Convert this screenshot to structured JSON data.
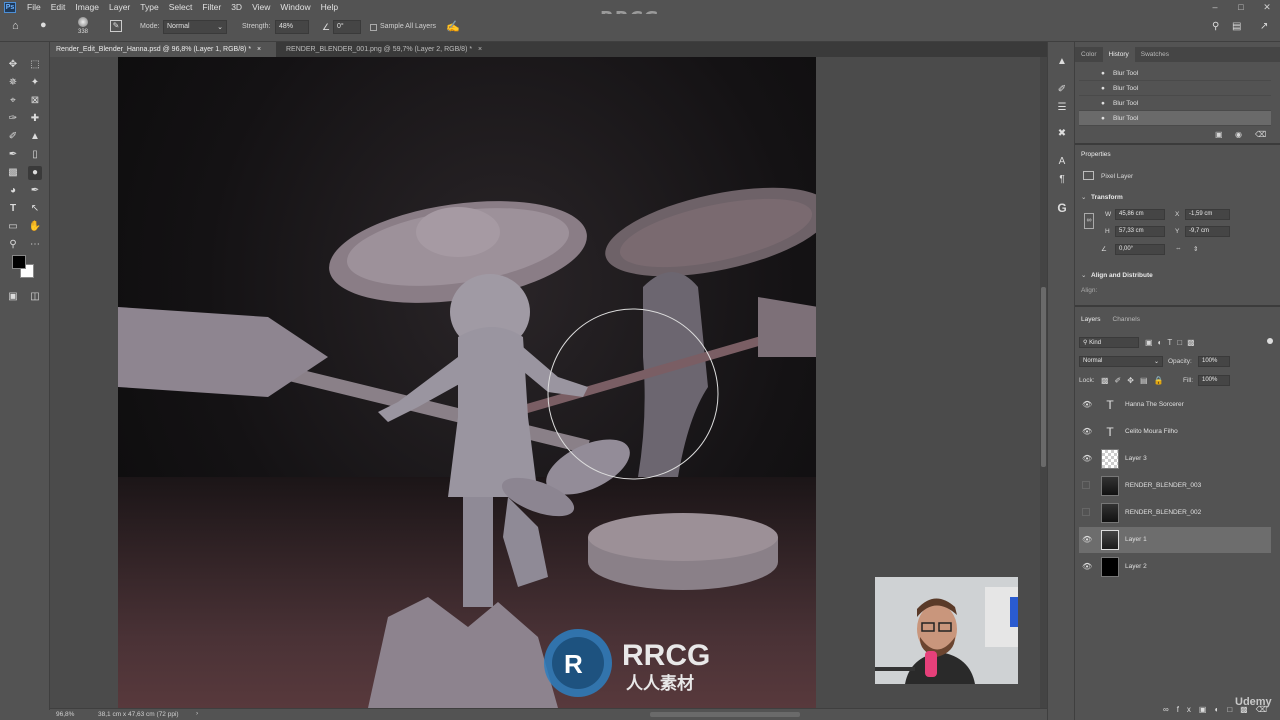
{
  "menubar": {
    "logo": "Ps",
    "items": [
      "File",
      "Edit",
      "Image",
      "Layer",
      "Type",
      "Select",
      "Filter",
      "3D",
      "View",
      "Window",
      "Help"
    ]
  },
  "watermark": {
    "top": "RRCG.cn",
    "logo_text": "RRCG",
    "logo_sub": "人人素材"
  },
  "options": {
    "brush_size": "338",
    "mode_label": "Mode:",
    "mode_value": "Normal",
    "strength_label": "Strength:",
    "strength_value": "48%",
    "angle_value": "0°",
    "sample_all_label": "Sample All Layers"
  },
  "tabs": [
    {
      "label": "Render_Edit_Blender_Hanna.psd @ 96,8% (Layer 1, RGB/8) *",
      "close": "×"
    },
    {
      "label": "RENDER_BLENDER_001.png @ 59,7% (Layer 2, RGB/8) *",
      "close": "×"
    }
  ],
  "statusbar": {
    "zoom": "96,8%",
    "doc_info": "38,1 cm x 47,63 cm (72 ppi)",
    "arrow": "›"
  },
  "history_panel": {
    "tabs": [
      "Color",
      "History",
      "Swatches"
    ],
    "items": [
      "Blur Tool",
      "Blur Tool",
      "Blur Tool",
      "Blur Tool"
    ]
  },
  "properties_panel": {
    "title": "Properties",
    "type": "Pixel Layer",
    "transform_title": "Transform",
    "w_label": "W",
    "w_value": "45,86 cm",
    "x_label": "X",
    "x_value": "-1,59 cm",
    "h_label": "H",
    "h_value": "57,33 cm",
    "y_label": "Y",
    "y_value": "-9,7 cm",
    "angle_value": "0,00°",
    "align_title": "Align and Distribute",
    "align_label": "Align:"
  },
  "layers_panel": {
    "tabs": [
      "Layers",
      "Channels"
    ],
    "filter_label": "Kind",
    "blend_mode": "Normal",
    "opacity_label": "Opacity:",
    "opacity_value": "100%",
    "lock_label": "Lock:",
    "fill_label": "Fill:",
    "fill_value": "100%",
    "layers": [
      {
        "name": "Hanna The Sorcerer",
        "kind": "text",
        "visible": true
      },
      {
        "name": "Celito Moura Filho",
        "kind": "text",
        "visible": true
      },
      {
        "name": "Layer 3",
        "kind": "transparent",
        "visible": true
      },
      {
        "name": "RENDER_BLENDER_003",
        "kind": "image",
        "visible": false
      },
      {
        "name": "RENDER_BLENDER_002",
        "kind": "image",
        "visible": false
      },
      {
        "name": "Layer 1",
        "kind": "image",
        "visible": true,
        "selected": true
      },
      {
        "name": "Layer 2",
        "kind": "black",
        "visible": true
      }
    ]
  },
  "udemy": "Udemy",
  "colors": {
    "foreground": "#000000",
    "background": "#ffffff",
    "ui_bg": "#535353"
  }
}
